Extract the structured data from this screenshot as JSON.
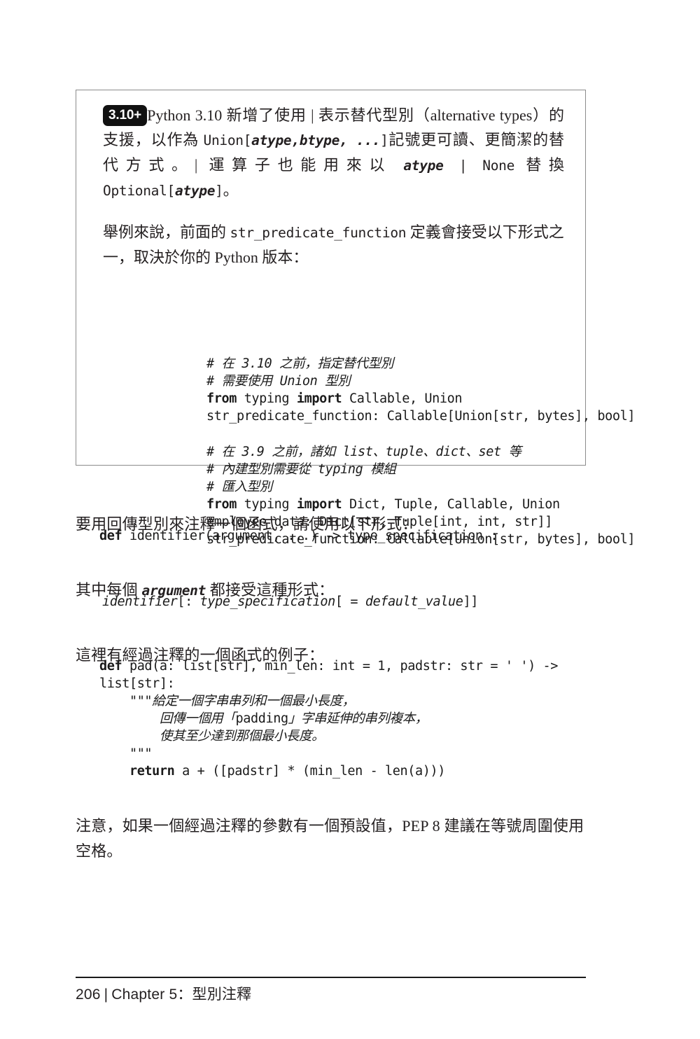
{
  "page": {
    "background": "#ffffff",
    "text_color": "#231f20"
  },
  "note_box": {
    "badge": "3.10+",
    "badge_bg": "#111111",
    "badge_fg": "#ffffff",
    "border_color": "#8b8b8b",
    "paragraph_1_parts": {
      "a": "Python 3.10 新增了使用 | 表示替代型別（alternative types）的支援，以作為 ",
      "code_1": "Union[",
      "code_1_italic": "atype,btype, ...",
      "code_1_end": "]",
      "b": "記號更可讀、更簡潔的替代方式。| 運算子也能用來以 ",
      "code_2_italic": "atype",
      "code_2": " | None",
      "c": " 替換 ",
      "code_3": "Optional[",
      "code_3_italic": "atype",
      "code_3_end": "]",
      "d": "。"
    },
    "paragraph_2_parts": {
      "a": "舉例來說，前面的 ",
      "code": "str_predicate_function",
      "b": " 定義會接受以下形式之一，取決於你的 Python 版本："
    },
    "code_block_1": [
      {
        "comment": true,
        "text_parts": [
          {
            "t": "# 在 ",
            "style": "cmt"
          },
          {
            "t": "3.10",
            "style": "cmt-i"
          },
          {
            "t": " 之前，指定替代型別",
            "style": "cmt"
          }
        ]
      },
      {
        "comment": true,
        "text_parts": [
          {
            "t": "# 需要使用 ",
            "style": "cmt"
          },
          {
            "t": "Union",
            "style": "cmt-i"
          },
          {
            "t": " 型別",
            "style": "cmt"
          }
        ]
      },
      {
        "comment": false,
        "text_parts": [
          {
            "t": "from",
            "style": "kw"
          },
          {
            "t": " typing ",
            "style": ""
          },
          {
            "t": "import",
            "style": "kw"
          },
          {
            "t": " Callable, Union",
            "style": ""
          }
        ]
      },
      {
        "comment": false,
        "text_parts": [
          {
            "t": "str_predicate_function: Callable[Union[str, bytes], bool]",
            "style": ""
          }
        ]
      }
    ],
    "code_block_2": [
      {
        "comment": true,
        "text_parts": [
          {
            "t": "# 在 ",
            "style": "cmt"
          },
          {
            "t": "3.9",
            "style": "cmt-i"
          },
          {
            "t": " 之前，諸如 ",
            "style": "cmt"
          },
          {
            "t": "list",
            "style": "cmt-i"
          },
          {
            "t": "、",
            "style": "cmt"
          },
          {
            "t": "tuple",
            "style": "cmt-i"
          },
          {
            "t": "、",
            "style": "cmt"
          },
          {
            "t": "dict",
            "style": "cmt-i"
          },
          {
            "t": "、",
            "style": "cmt"
          },
          {
            "t": "set",
            "style": "cmt-i"
          },
          {
            "t": " 等",
            "style": "cmt"
          }
        ]
      },
      {
        "comment": true,
        "text_parts": [
          {
            "t": "# 內建型別需要從 ",
            "style": "cmt"
          },
          {
            "t": "typing",
            "style": "cmt-i"
          },
          {
            "t": " 模組",
            "style": "cmt"
          }
        ]
      },
      {
        "comment": true,
        "text_parts": [
          {
            "t": "# 匯入型別",
            "style": "cmt"
          }
        ]
      },
      {
        "comment": false,
        "text_parts": [
          {
            "t": "from",
            "style": "kw"
          },
          {
            "t": " typing ",
            "style": ""
          },
          {
            "t": "import",
            "style": "kw"
          },
          {
            "t": " Dict, Tuple, Callable, Union",
            "style": ""
          }
        ]
      },
      {
        "comment": false,
        "text_parts": [
          {
            "t": "employee_data: Dict[str, Tuple[int, int, str]]",
            "style": ""
          }
        ]
      },
      {
        "comment": false,
        "text_parts": [
          {
            "t": "str_predicate_function: Callable[Union[str, bytes], bool]",
            "style": ""
          }
        ]
      }
    ]
  },
  "body": {
    "para_return_type": "要用回傳型別來注釋一個函式，請使用以下形式：",
    "code_def_form": [
      {
        "t": "def",
        "style": "kw"
      },
      {
        "t": " identifier(argument, ...) -> type_specification :",
        "style": ""
      }
    ],
    "para_each_arg_parts": {
      "a": "其中每個 ",
      "italic": "argument",
      "b": " 都接受這種形式："
    },
    "code_arg_form": [
      {
        "t": "identifier",
        "style": "it"
      },
      {
        "t": "[: ",
        "style": ""
      },
      {
        "t": "type_specification",
        "style": "it"
      },
      {
        "t": "[ = ",
        "style": ""
      },
      {
        "t": "default_value",
        "style": "it"
      },
      {
        "t": "]]",
        "style": ""
      }
    ],
    "para_example": "這裡有經過注釋的一個函式的例子：",
    "code_pad": [
      {
        "text_parts": [
          {
            "t": "def",
            "style": "kw"
          },
          {
            "t": " pad(a: list[str], min_len: int = 1, padstr: str = ' ') ->",
            "style": ""
          }
        ]
      },
      {
        "text_parts": [
          {
            "t": "list[str]:",
            "style": ""
          }
        ]
      },
      {
        "text_parts": [
          {
            "t": "    \"\"\"",
            "style": ""
          },
          {
            "t": "給定一個字串串列和一個最小長度，",
            "style": "cmt"
          }
        ]
      },
      {
        "text_parts": [
          {
            "t": "        ",
            "style": ""
          },
          {
            "t": "回傳一個用「",
            "style": "cmt"
          },
          {
            "t": "padding",
            "style": ""
          },
          {
            "t": "」字串延伸的串列複本，",
            "style": "cmt"
          }
        ]
      },
      {
        "text_parts": [
          {
            "t": "        ",
            "style": ""
          },
          {
            "t": "使其至少達到那個最小長度。",
            "style": "cmt"
          }
        ]
      },
      {
        "text_parts": [
          {
            "t": "    \"\"\"",
            "style": ""
          }
        ]
      },
      {
        "text_parts": [
          {
            "t": "    ",
            "style": ""
          },
          {
            "t": "return",
            "style": "kw"
          },
          {
            "t": " a + ([padstr] * (min_len - len(a)))",
            "style": ""
          }
        ]
      }
    ],
    "para_note_pep8": "注意，如果一個經過注釋的參數有一個預設值，PEP 8 建議在等號周圍使用空格。"
  },
  "footer": {
    "page_number": "206",
    "separator": "|",
    "chapter": "Chapter 5：型別注釋"
  }
}
